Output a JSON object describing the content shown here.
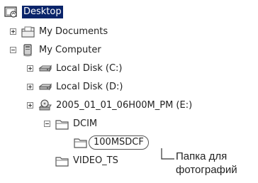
{
  "tree": {
    "desktop": "Desktop",
    "my_documents": "My Documents",
    "my_computer": "My Computer",
    "local_disk_c": "Local Disk (C:)",
    "local_disk_d": "Local Disk (D:)",
    "removable_e": "2005_01_01_06H00M_PM (E:)",
    "dcim": "DCIM",
    "folder_100msdcf": "100MSDCF",
    "video_ts": "VIDEO_TS"
  },
  "annotation": {
    "line1": "Папка для",
    "line2": "фотографий"
  },
  "icons": {
    "desktop": "desktop-icon",
    "my_documents": "documents-folder-icon",
    "my_computer": "computer-icon",
    "local_disk": "hard-disk-icon",
    "removable": "removable-disk-icon",
    "folder": "folder-icon"
  }
}
